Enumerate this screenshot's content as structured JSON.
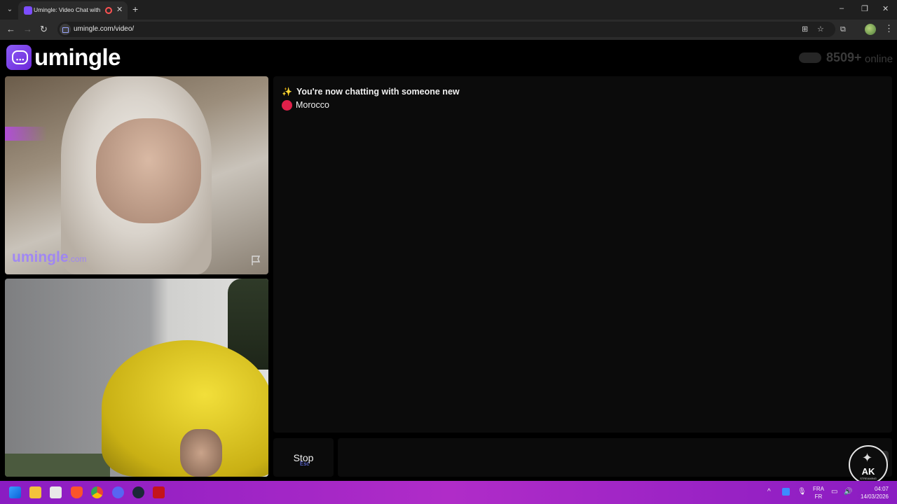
{
  "browser": {
    "tab_list_icon": "chevron-down-icon",
    "tab_title": "Umingle: Video Chat with S",
    "tab_close": "✕",
    "new_tab": "+",
    "url": "umingle.com/video/",
    "window_controls": {
      "minimize": "–",
      "maximize": "❐",
      "close": "✕"
    },
    "nav": {
      "back": "←",
      "forward": "→",
      "reload": "↻"
    },
    "omni_icons": {
      "translate": "⊞",
      "bookmark": "☆",
      "extensions": "⧉"
    },
    "menu": "⋮"
  },
  "header": {
    "logo_text": "umingle",
    "logo_dots": "•••",
    "online_count": "8509+",
    "online_label": "online"
  },
  "videos": {
    "watermark_main": "umingle",
    "watermark_suffix": ".com"
  },
  "chat": {
    "sparkle": "✨",
    "headline": "You're now chatting with someone new",
    "country": "Morocco",
    "country_dot_color": "#e0204a"
  },
  "controls": {
    "stop_label": "Stop",
    "stop_hint": "Esc",
    "message_placeholder": ""
  },
  "overlay": {
    "badge_text": "AK",
    "badge_sub": "STREAMING",
    "badge_icon": "✦"
  },
  "taskbar": {
    "apps": [
      "windows-start",
      "file-explorer",
      "microsoft-store",
      "brave",
      "chrome",
      "discord",
      "steam",
      "adobe-reader"
    ],
    "tray_chevron": "^",
    "lang_top": "FRA",
    "lang_bottom": "FR",
    "time": "04:07",
    "date": "14/03/2026"
  },
  "colors": {
    "brand_purple": "#7c4dff",
    "taskbar_purple": "#a526c7",
    "background": "#000000"
  }
}
